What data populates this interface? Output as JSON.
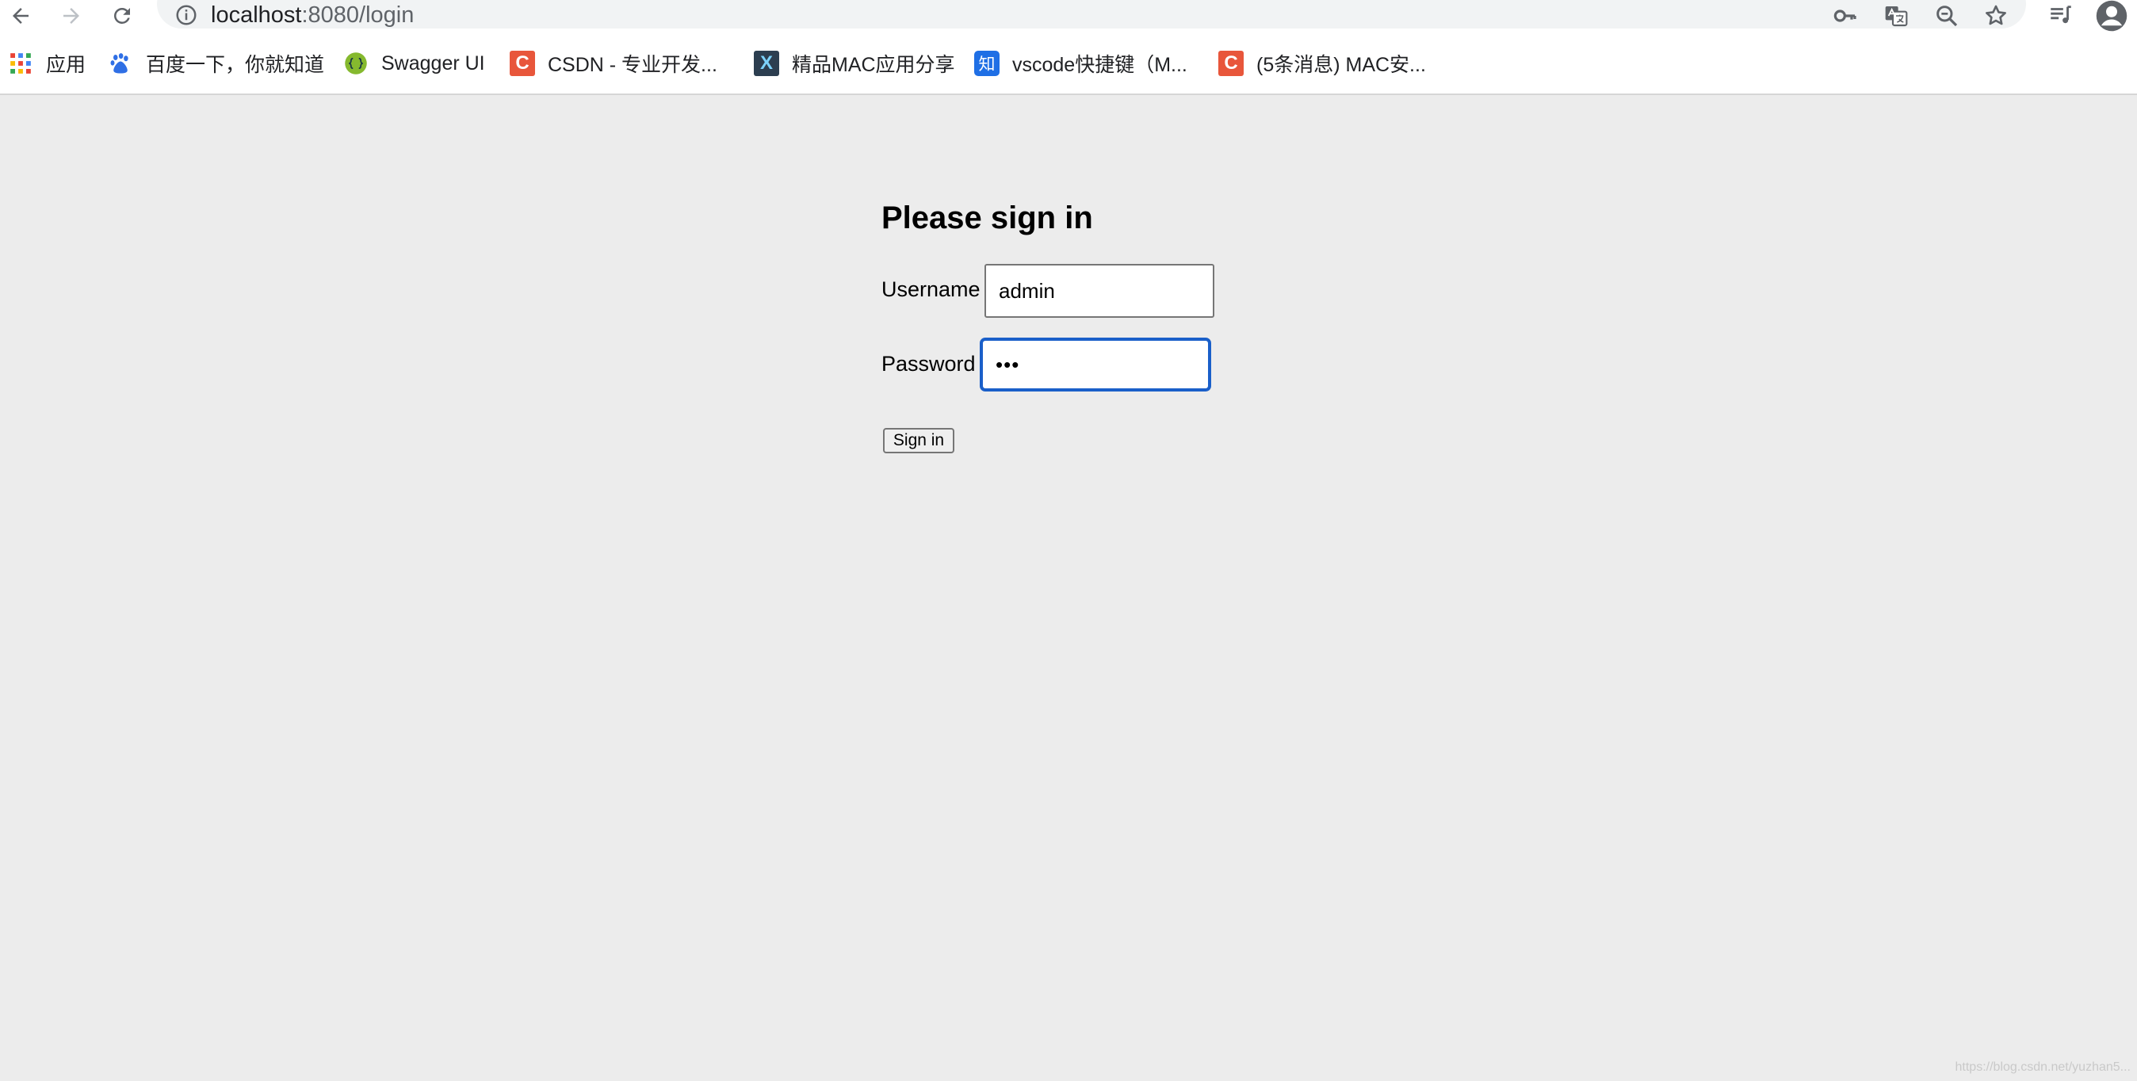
{
  "browser": {
    "url_host": "localhost",
    "url_rest": ":8080/login"
  },
  "bookmarks": [
    {
      "label": "应用",
      "icon": "apps-grid-icon"
    },
    {
      "label": "百度一下，你就知道",
      "icon": "baidu-paw-icon"
    },
    {
      "label": "Swagger UI",
      "icon": "swagger-icon"
    },
    {
      "label": "CSDN - 专业开发...",
      "icon": "csdn-icon",
      "icon_text": "C"
    },
    {
      "label": "精品MAC应用分享",
      "icon": "x-logo-icon",
      "icon_text": "X"
    },
    {
      "label": "vscode快捷键（M...",
      "icon": "zhihu-icon",
      "icon_text": "知"
    },
    {
      "label": "(5条消息) MAC安...",
      "icon": "csdn-icon",
      "icon_text": "C"
    }
  ],
  "form": {
    "heading": "Please sign in",
    "username_label": "Username",
    "username_value": "admin",
    "password_label": "Password",
    "password_value": "•••",
    "submit_label": "Sign in"
  },
  "watermark": "https://blog.csdn.net/yuzhan5...",
  "colors": {
    "page_background": "#ececec",
    "focus_ring": "#1a5fc9",
    "csdn_red": "#e8563b",
    "zhihu_blue": "#1f6fe5"
  }
}
